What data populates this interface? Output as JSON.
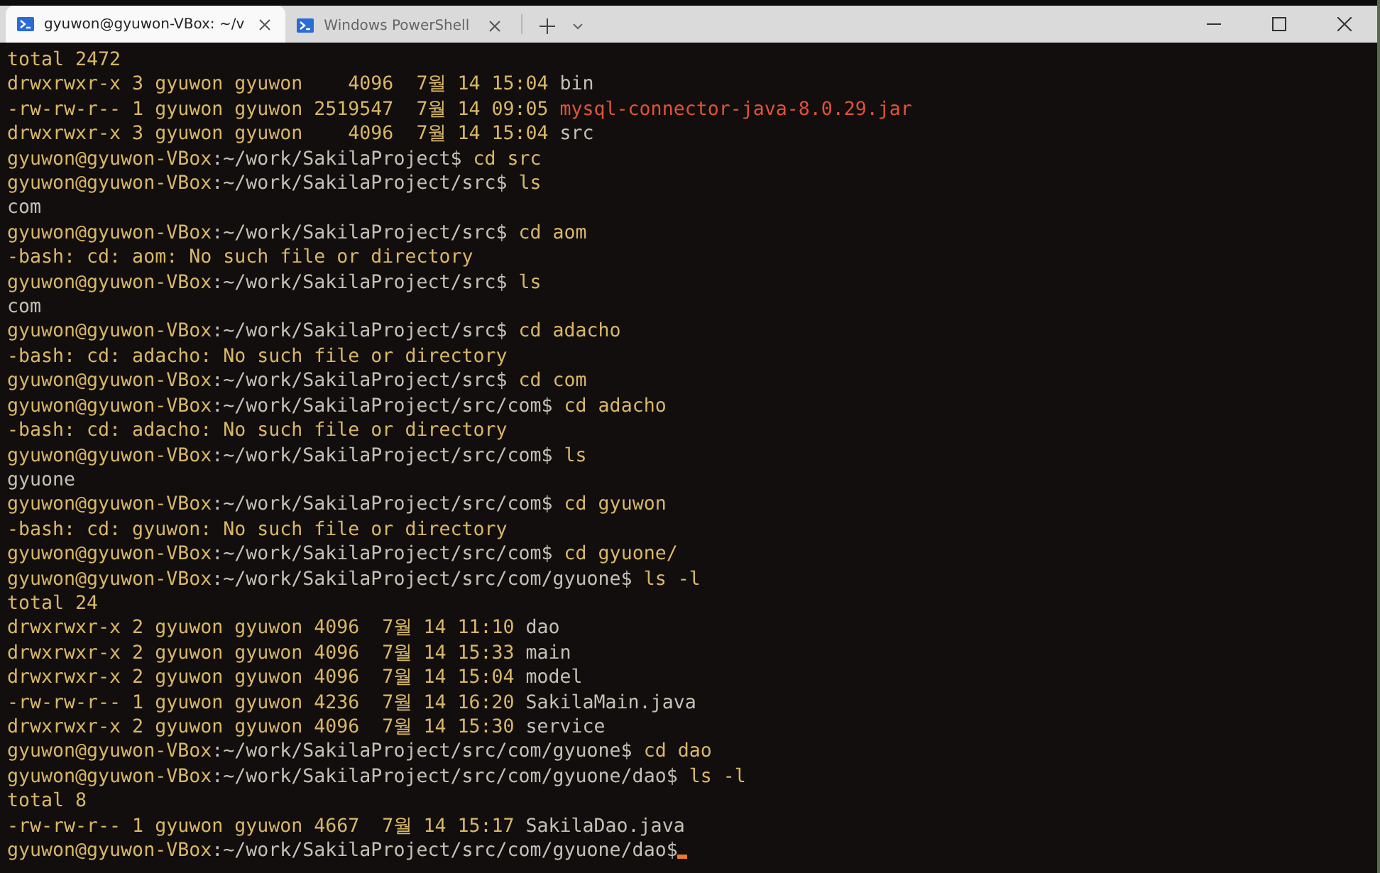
{
  "tabs": [
    {
      "title": "gyuwon@gyuwon-VBox: ~/v",
      "selected": true
    },
    {
      "title": "Windows PowerShell",
      "selected": false
    }
  ],
  "lines": [
    [
      {
        "t": "total 2472",
        "kind": "text"
      }
    ],
    [
      {
        "t": "drwxrwxr-x 3 gyuwon gyuwon    4096  7월 14 15:04 ",
        "kind": "text"
      },
      {
        "t": "bin",
        "kind": "dim"
      }
    ],
    [
      {
        "t": "-rw-rw-r-- 1 gyuwon gyuwon 2519547  7월 14 09:05 ",
        "kind": "text"
      },
      {
        "t": "mysql-connector-java-8.0.29.jar",
        "kind": "alert"
      }
    ],
    [
      {
        "t": "drwxrwxr-x 3 gyuwon gyuwon    4096  7월 14 15:04 ",
        "kind": "text"
      },
      {
        "t": "src",
        "kind": "dim"
      }
    ],
    [
      {
        "t": "gyuwon@gyuwon-VBox",
        "kind": "text"
      },
      {
        "t": ":~/work/SakilaProject$",
        "kind": "dim"
      },
      {
        "t": " cd src",
        "kind": "text"
      }
    ],
    [
      {
        "t": "gyuwon@gyuwon-VBox",
        "kind": "text"
      },
      {
        "t": ":~/work/SakilaProject/src$",
        "kind": "dim"
      },
      {
        "t": " ls",
        "kind": "text"
      }
    ],
    [
      {
        "t": "com",
        "kind": "dim"
      }
    ],
    [
      {
        "t": "gyuwon@gyuwon-VBox",
        "kind": "text"
      },
      {
        "t": ":~/work/SakilaProject/src$",
        "kind": "dim"
      },
      {
        "t": " cd aom",
        "kind": "text"
      }
    ],
    [
      {
        "t": "-bash: cd: aom: No such file or directory",
        "kind": "text"
      }
    ],
    [
      {
        "t": "gyuwon@gyuwon-VBox",
        "kind": "text"
      },
      {
        "t": ":~/work/SakilaProject/src$",
        "kind": "dim"
      },
      {
        "t": " ls",
        "kind": "text"
      }
    ],
    [
      {
        "t": "com",
        "kind": "dim"
      }
    ],
    [
      {
        "t": "gyuwon@gyuwon-VBox",
        "kind": "text"
      },
      {
        "t": ":~/work/SakilaProject/src$",
        "kind": "dim"
      },
      {
        "t": " cd adacho",
        "kind": "text"
      }
    ],
    [
      {
        "t": "-bash: cd: adacho: No such file or directory",
        "kind": "text"
      }
    ],
    [
      {
        "t": "gyuwon@gyuwon-VBox",
        "kind": "text"
      },
      {
        "t": ":~/work/SakilaProject/src$",
        "kind": "dim"
      },
      {
        "t": " cd com",
        "kind": "text"
      }
    ],
    [
      {
        "t": "gyuwon@gyuwon-VBox",
        "kind": "text"
      },
      {
        "t": ":~/work/SakilaProject/src/com$",
        "kind": "dim"
      },
      {
        "t": " cd adacho",
        "kind": "text"
      }
    ],
    [
      {
        "t": "-bash: cd: adacho: No such file or directory",
        "kind": "text"
      }
    ],
    [
      {
        "t": "gyuwon@gyuwon-VBox",
        "kind": "text"
      },
      {
        "t": ":~/work/SakilaProject/src/com$",
        "kind": "dim"
      },
      {
        "t": " ls",
        "kind": "text"
      }
    ],
    [
      {
        "t": "gyuone",
        "kind": "dim"
      }
    ],
    [
      {
        "t": "gyuwon@gyuwon-VBox",
        "kind": "text"
      },
      {
        "t": ":~/work/SakilaProject/src/com$",
        "kind": "dim"
      },
      {
        "t": " cd gyuwon",
        "kind": "text"
      }
    ],
    [
      {
        "t": "-bash: cd: gyuwon: No such file or directory",
        "kind": "text"
      }
    ],
    [
      {
        "t": "gyuwon@gyuwon-VBox",
        "kind": "text"
      },
      {
        "t": ":~/work/SakilaProject/src/com$",
        "kind": "dim"
      },
      {
        "t": " cd gyuone/",
        "kind": "text"
      }
    ],
    [
      {
        "t": "gyuwon@gyuwon-VBox",
        "kind": "text"
      },
      {
        "t": ":~/work/SakilaProject/src/com/gyuone$",
        "kind": "dim"
      },
      {
        "t": " ls -l",
        "kind": "text"
      }
    ],
    [
      {
        "t": "total 24",
        "kind": "text"
      }
    ],
    [
      {
        "t": "drwxrwxr-x 2 gyuwon gyuwon 4096  7월 14 11:10 ",
        "kind": "text"
      },
      {
        "t": "dao",
        "kind": "dim"
      }
    ],
    [
      {
        "t": "drwxrwxr-x 2 gyuwon gyuwon 4096  7월 14 15:33 ",
        "kind": "text"
      },
      {
        "t": "main",
        "kind": "dim"
      }
    ],
    [
      {
        "t": "drwxrwxr-x 2 gyuwon gyuwon 4096  7월 14 15:04 ",
        "kind": "text"
      },
      {
        "t": "model",
        "kind": "dim"
      }
    ],
    [
      {
        "t": "-rw-rw-r-- 1 gyuwon gyuwon 4236  7월 14 16:20 ",
        "kind": "text"
      },
      {
        "t": "SakilaMain.java",
        "kind": "dim"
      }
    ],
    [
      {
        "t": "drwxrwxr-x 2 gyuwon gyuwon 4096  7월 14 15:30 ",
        "kind": "text"
      },
      {
        "t": "service",
        "kind": "dim"
      }
    ],
    [
      {
        "t": "gyuwon@gyuwon-VBox",
        "kind": "text"
      },
      {
        "t": ":~/work/SakilaProject/src/com/gyuone$",
        "kind": "dim"
      },
      {
        "t": " cd dao",
        "kind": "text"
      }
    ],
    [
      {
        "t": "gyuwon@gyuwon-VBox",
        "kind": "text"
      },
      {
        "t": ":~/work/SakilaProject/src/com/gyuone/dao$",
        "kind": "dim"
      },
      {
        "t": " ls -l",
        "kind": "text"
      }
    ],
    [
      {
        "t": "total 8",
        "kind": "text"
      }
    ],
    [
      {
        "t": "-rw-rw-r-- 1 gyuwon gyuwon 4667  7월 14 15:17 ",
        "kind": "text"
      },
      {
        "t": "SakilaDao.java",
        "kind": "dim"
      }
    ],
    [
      {
        "t": "gyuwon@gyuwon-VBox",
        "kind": "text"
      },
      {
        "t": ":~/work/SakilaProject/src/com/gyuone/dao$",
        "kind": "dim"
      }
    ]
  ]
}
